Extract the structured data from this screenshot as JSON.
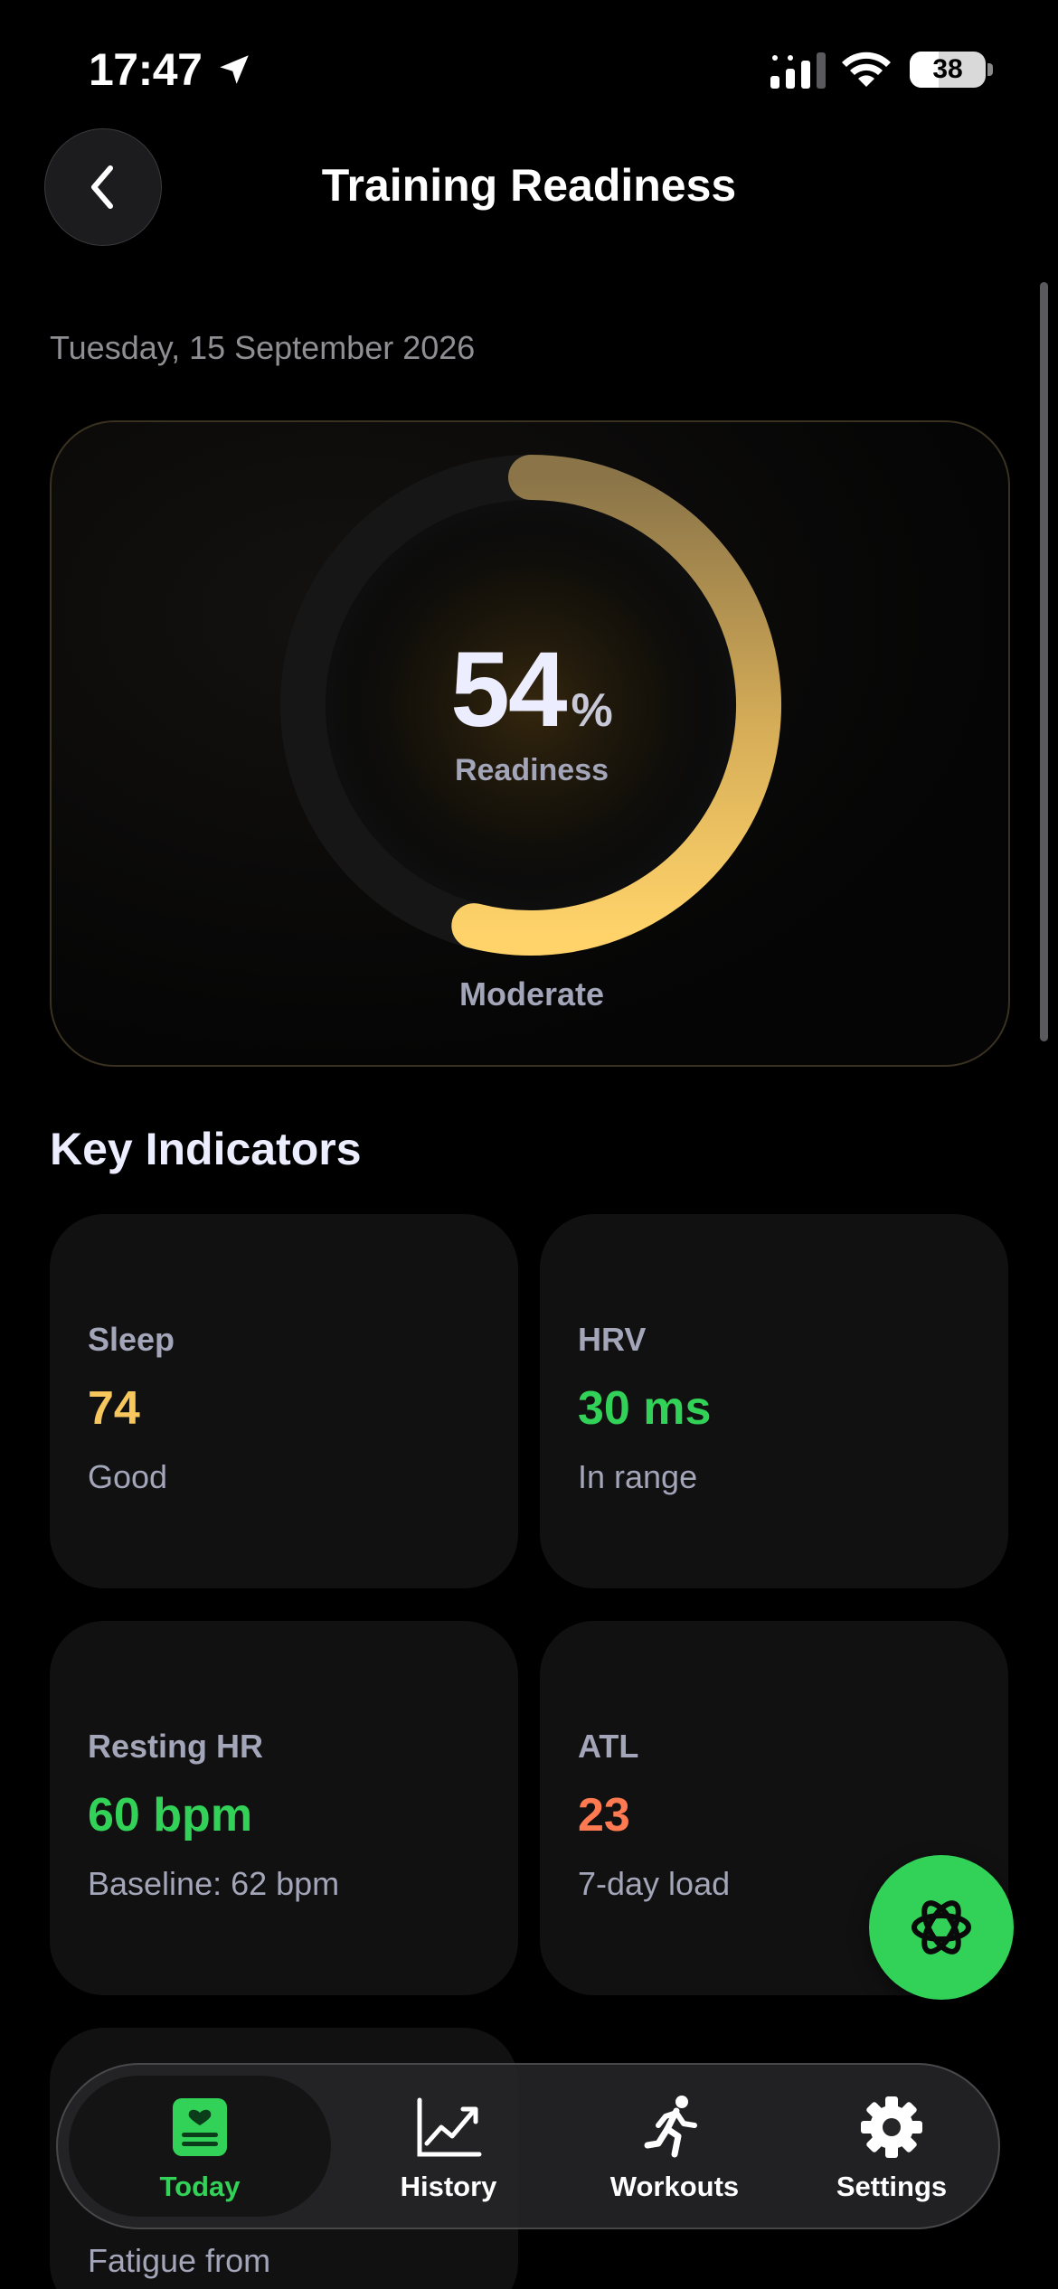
{
  "status_bar": {
    "time": "17:47",
    "battery": "38"
  },
  "header": {
    "title": "Training Readiness"
  },
  "date": "Tuesday, 15 September 2026",
  "readiness": {
    "value": "54",
    "unit": "%",
    "caption": "Readiness",
    "status": "Moderate",
    "fraction": 0.54,
    "accent": "#f2c45e"
  },
  "section_title": "Key Indicators",
  "indicators": [
    {
      "label": "Sleep",
      "value": "74",
      "sub": "Good",
      "color": "#f7c75e"
    },
    {
      "label": "HRV",
      "value": "30 ms",
      "sub": "In range",
      "color": "#32d158"
    },
    {
      "label": "Resting HR",
      "value": "60 bpm",
      "sub": "Baseline: 62 bpm",
      "color": "#32d158"
    },
    {
      "label": "ATL",
      "value": "23",
      "sub": "7-day load",
      "color": "#ff7a50"
    }
  ],
  "partial_card": {
    "sub": "Fatigue from"
  },
  "tabs": [
    {
      "label": "Today",
      "icon": "heart-card-icon",
      "active": true
    },
    {
      "label": "History",
      "icon": "chart-line-icon",
      "active": false
    },
    {
      "label": "Workouts",
      "icon": "running-figure-icon",
      "active": false
    },
    {
      "label": "Settings",
      "icon": "gear-icon",
      "active": false
    }
  ],
  "fab": {
    "icon": "ai-assistant-icon"
  }
}
